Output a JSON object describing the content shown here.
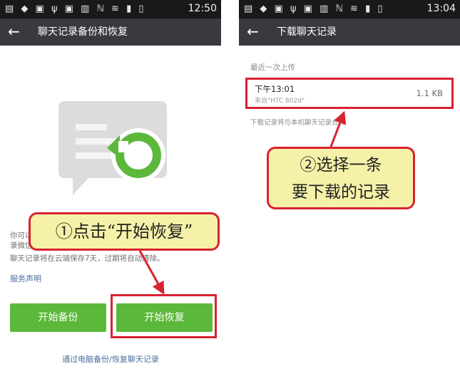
{
  "colors": {
    "status_bar": "#191919",
    "toolbar": "#393a3f",
    "primary_button": "#5cb83a",
    "link": "#4a6d9e",
    "annotation_red": "#d92231",
    "callout_fill": "#f5f1a8"
  },
  "left_screen": {
    "status": {
      "time": "12:50",
      "icons": "▤ ◆ ▣ ψ ▣ ▥ ℕ ≋ ▮ ▯"
    },
    "toolbar": {
      "back_icon": "←",
      "title": "聊天记录备份和恢复"
    },
    "illustration": {
      "icon": "chat-restore-icon"
    },
    "description_line1": "你可以",
    "description_line2": "录微信",
    "retention_text": "聊天记录将在云端保存7天，过期将自动清除。",
    "service_link": "服务声明",
    "backup_button": "开始备份",
    "restore_button": "开始恢复",
    "pc_link": "通过电脑备份/恢复聊天记录"
  },
  "right_screen": {
    "status": {
      "time": "13:04",
      "icons": "▤ ◆ ▣ ψ ▣ ▥ ℕ ≋ ▮ ▯"
    },
    "toolbar": {
      "back_icon": "←",
      "title": "下载聊天记录"
    },
    "section_label": "最近一次上传",
    "record": {
      "time": "下午13:01",
      "source": "来自\"HTC 802d\"",
      "size": "1.1 KB"
    },
    "note": "下载记录将与本机聊天记录合并"
  },
  "annotations": {
    "callout1": "①点击“开始恢复”",
    "callout2_line1": "②选择一条",
    "callout2_line2": "要下载的记录"
  }
}
